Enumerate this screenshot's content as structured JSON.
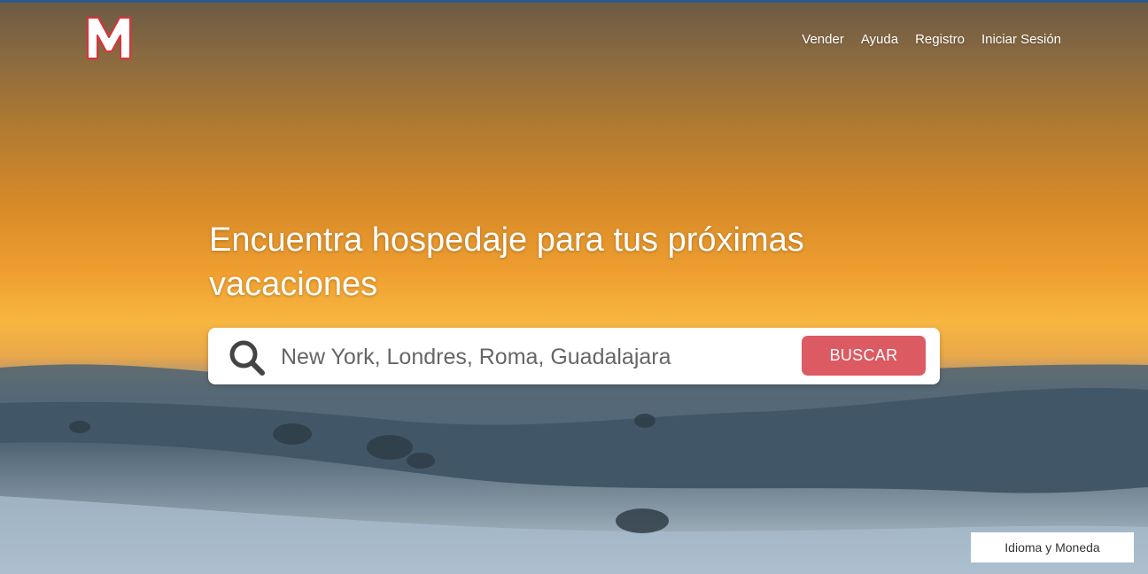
{
  "brand": {
    "logo_letter": "M",
    "logo_color": "#ffffff",
    "logo_outline": "#e0303a"
  },
  "nav": {
    "items": [
      {
        "label": "Vender"
      },
      {
        "label": "Ayuda"
      },
      {
        "label": "Registro"
      },
      {
        "label": "Iniciar Sesión"
      }
    ]
  },
  "hero": {
    "headline": "Encuentra hospedaje para tus próximas vacaciones"
  },
  "search": {
    "placeholder": "New York, Londres, Roma, Guadalajara",
    "value": "",
    "button_label": "BUSCAR",
    "icon": "search-icon",
    "button_color": "#dc5a62"
  },
  "footer": {
    "language_currency_label": "Idioma y Moneda"
  }
}
